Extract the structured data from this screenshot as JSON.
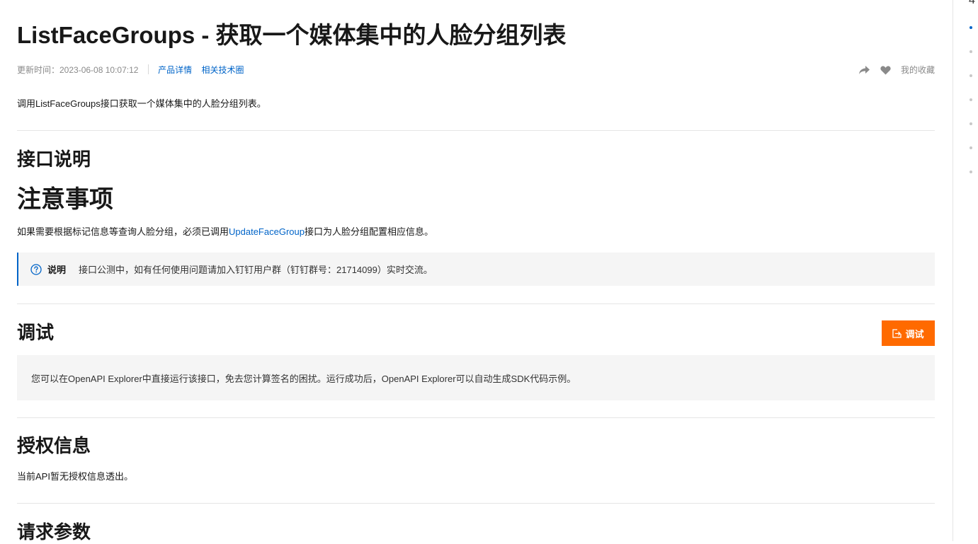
{
  "page": {
    "title": "ListFaceGroups - 获取一个媒体集中的人脸分组列表",
    "updated": "更新时间：2023-06-08 10:07:12",
    "links": [
      "产品详情",
      "相关技术圈"
    ],
    "favorite_label": "我的收藏",
    "intro": "调用ListFaceGroups接口获取一个媒体集中的人脸分组列表。"
  },
  "sections": {
    "api_desc": {
      "heading": "接口说明"
    },
    "notes": {
      "heading": "注意事项",
      "text_before": "如果需要根据标记信息等查询人脸分组，必须已调用",
      "link": "UpdateFaceGroup",
      "text_after": "接口为人脸分组配置相应信息。",
      "callout_label": "说明",
      "callout_text": "接口公测中，如有任何使用问题请加入钉钉用户群（钉钉群号：21714099）实时交流。"
    },
    "debug": {
      "heading": "调试",
      "button": "调试",
      "text": "您可以在OpenAPI Explorer中直接运行该接口，免去您计算签名的困扰。运行成功后，OpenAPI Explorer可以自动生成SDK代码示例。"
    },
    "auth": {
      "heading": "授权信息",
      "text": "当前API暂无授权信息透出。"
    },
    "request": {
      "heading": "请求参数"
    }
  },
  "toc": {
    "top_glyph": "4",
    "dot_count": 7,
    "active_index": 0
  },
  "colors": {
    "link": "#0064c8",
    "accent": "#ff6a00",
    "callout_bg": "#f5f5f5"
  }
}
